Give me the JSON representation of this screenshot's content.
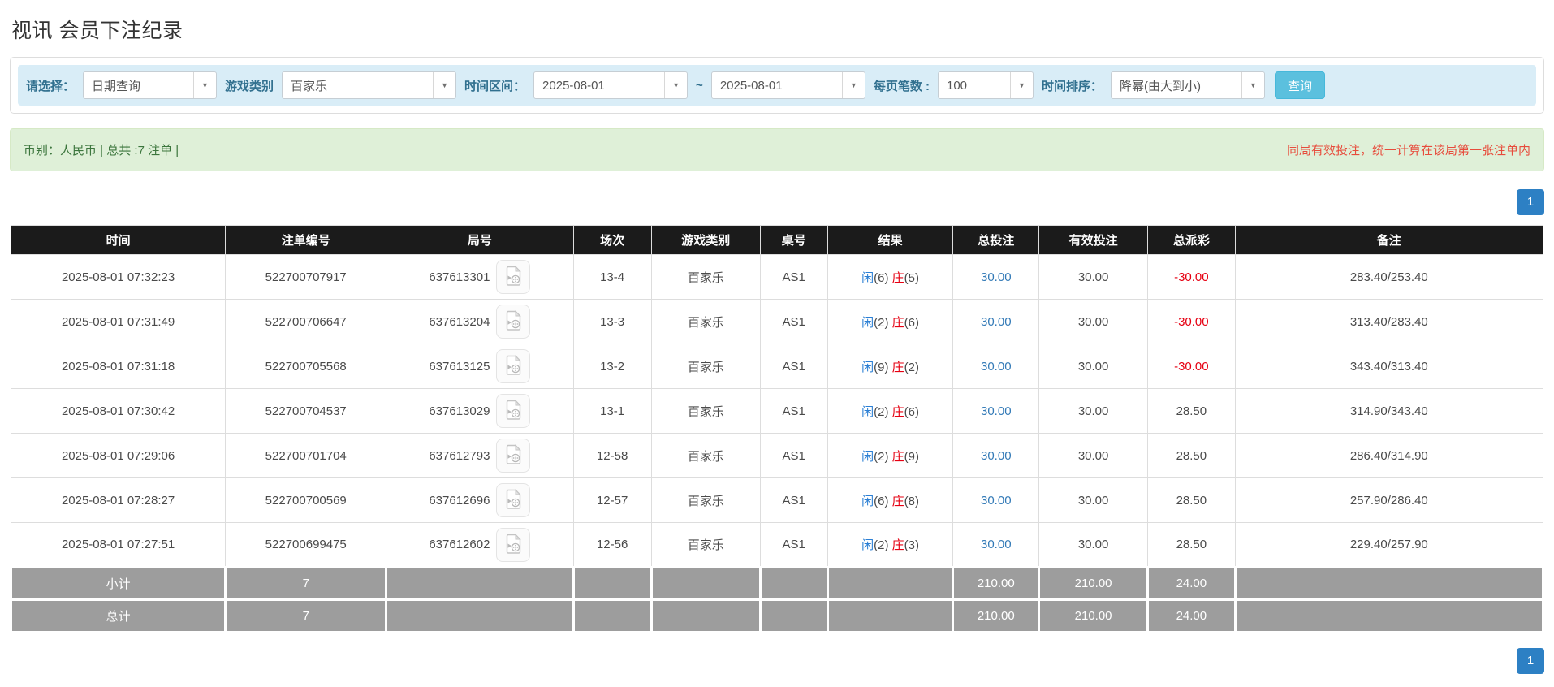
{
  "page": {
    "title": "视讯 会员下注纪录"
  },
  "filters": {
    "query_type": {
      "label": "请选择：",
      "value": "日期查询"
    },
    "game_type": {
      "label": "游戏类别",
      "value": "百家乐"
    },
    "time_range": {
      "label": "时间区间：",
      "from": "2025-08-01",
      "separator": "~",
      "to": "2025-08-01"
    },
    "page_size": {
      "label": "每页笔数 :",
      "value": "100"
    },
    "time_sort": {
      "label": "时间排序：",
      "value": "降幂(由大到小)"
    },
    "search_button_label": "查询"
  },
  "summary": {
    "left": "币别：人民币 | 总共 :7 注单 |",
    "right": "同局有效投注，统一计算在该局第一张注单内"
  },
  "pagination": {
    "page": "1"
  },
  "table": {
    "headers": [
      "时间",
      "注单编号",
      "局号",
      "场次",
      "游戏类别",
      "桌号",
      "结果",
      "总投注",
      "有效投注",
      "总派彩",
      "备注"
    ],
    "icon_name": "video-replay-icon",
    "rows": [
      {
        "time": "2025-08-01 07:32:23",
        "bet_id": "522700707917",
        "round_id": "637613301",
        "session": "13-4",
        "game": "百家乐",
        "table_no": "AS1",
        "result": {
          "player": "闲",
          "player_score": "(6)",
          "banker": "庄",
          "banker_score": "(5)"
        },
        "total_bet": "30.00",
        "valid_bet": "30.00",
        "payout": "-30.00",
        "note": "283.40/253.40"
      },
      {
        "time": "2025-08-01 07:31:49",
        "bet_id": "522700706647",
        "round_id": "637613204",
        "session": "13-3",
        "game": "百家乐",
        "table_no": "AS1",
        "result": {
          "player": "闲",
          "player_score": "(2)",
          "banker": "庄",
          "banker_score": "(6)"
        },
        "total_bet": "30.00",
        "valid_bet": "30.00",
        "payout": "-30.00",
        "note": "313.40/283.40"
      },
      {
        "time": "2025-08-01 07:31:18",
        "bet_id": "522700705568",
        "round_id": "637613125",
        "session": "13-2",
        "game": "百家乐",
        "table_no": "AS1",
        "result": {
          "player": "闲",
          "player_score": "(9)",
          "banker": "庄",
          "banker_score": "(2)"
        },
        "total_bet": "30.00",
        "valid_bet": "30.00",
        "payout": "-30.00",
        "note": "343.40/313.40"
      },
      {
        "time": "2025-08-01 07:30:42",
        "bet_id": "522700704537",
        "round_id": "637613029",
        "session": "13-1",
        "game": "百家乐",
        "table_no": "AS1",
        "result": {
          "player": "闲",
          "player_score": "(2)",
          "banker": "庄",
          "banker_score": "(6)"
        },
        "total_bet": "30.00",
        "valid_bet": "30.00",
        "payout": "28.50",
        "note": "314.90/343.40"
      },
      {
        "time": "2025-08-01 07:29:06",
        "bet_id": "522700701704",
        "round_id": "637612793",
        "session": "12-58",
        "game": "百家乐",
        "table_no": "AS1",
        "result": {
          "player": "闲",
          "player_score": "(2)",
          "banker": "庄",
          "banker_score": "(9)"
        },
        "total_bet": "30.00",
        "valid_bet": "30.00",
        "payout": "28.50",
        "note": "286.40/314.90"
      },
      {
        "time": "2025-08-01 07:28:27",
        "bet_id": "522700700569",
        "round_id": "637612696",
        "session": "12-57",
        "game": "百家乐",
        "table_no": "AS1",
        "result": {
          "player": "闲",
          "player_score": "(6)",
          "banker": "庄",
          "banker_score": "(8)"
        },
        "total_bet": "30.00",
        "valid_bet": "30.00",
        "payout": "28.50",
        "note": "257.90/286.40"
      },
      {
        "time": "2025-08-01 07:27:51",
        "bet_id": "522700699475",
        "round_id": "637612602",
        "session": "12-56",
        "game": "百家乐",
        "table_no": "AS1",
        "result": {
          "player": "闲",
          "player_score": "(2)",
          "banker": "庄",
          "banker_score": "(3)"
        },
        "total_bet": "30.00",
        "valid_bet": "30.00",
        "payout": "28.50",
        "note": "229.40/257.90"
      }
    ],
    "footer": [
      {
        "label": "小计",
        "count": "7",
        "total_bet": "210.00",
        "valid_bet": "210.00",
        "payout": "24.00"
      },
      {
        "label": "总计",
        "count": "7",
        "total_bet": "210.00",
        "valid_bet": "210.00",
        "payout": "24.00"
      }
    ]
  },
  "colors": {
    "link_blue": "#337ab7",
    "player_blue": "#2b7fd4",
    "banker_red": "#e60012",
    "negative_red": "#e60012",
    "header_bg": "#1b1b1b",
    "footer_bg": "#9d9d9d",
    "filter_bar_bg": "#d9edf7",
    "summary_bg": "#dff0d8",
    "search_button_bg": "#5bc0de",
    "pagination_blue": "#2d80c4"
  }
}
